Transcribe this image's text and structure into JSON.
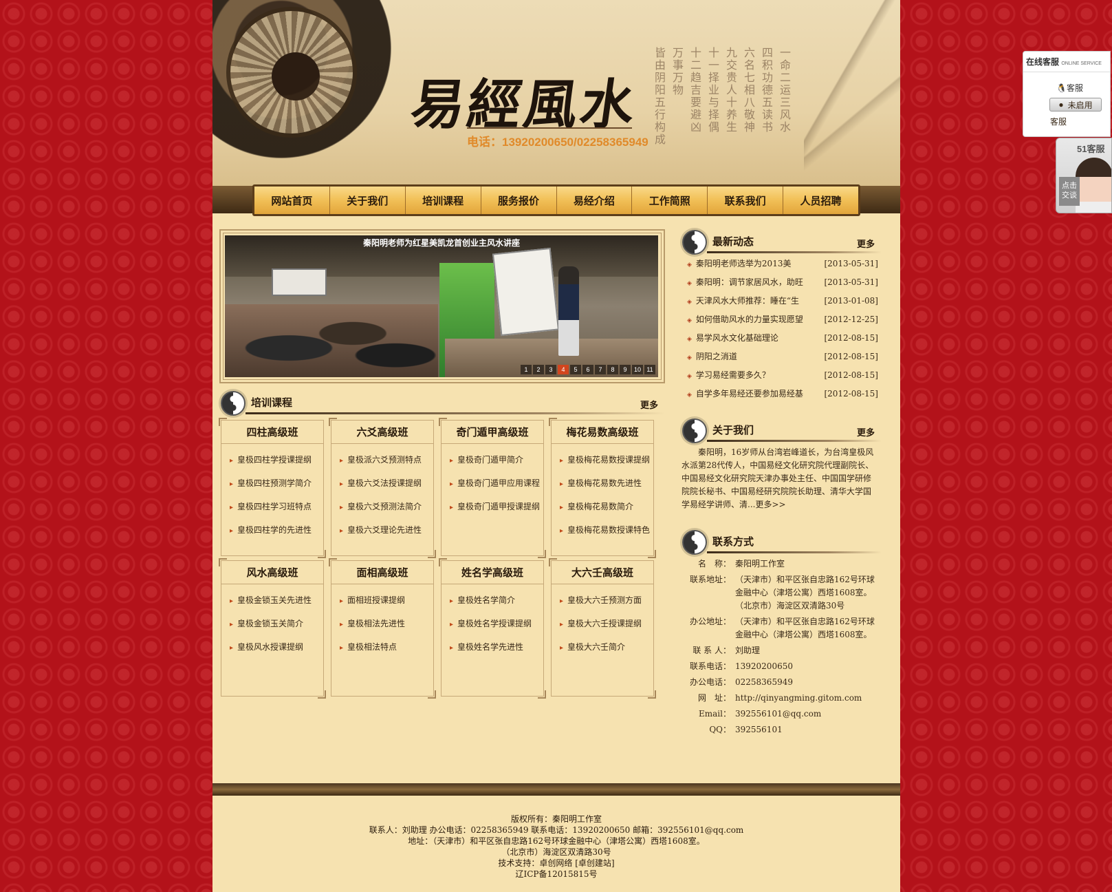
{
  "header": {
    "brand": "易經風水",
    "phone": "电话：13920200650/02258365949",
    "poem": [
      "一命二运三风水",
      "四积功德五读书",
      "六名七相八敬神",
      "九交贵人十养生",
      "十一择业与择偶",
      "十二趋吉要避凶",
      "万事万物",
      "皆由阴阳五行构成"
    ]
  },
  "nav": [
    "网站首页",
    "关于我们",
    "培训课程",
    "服务报价",
    "易经介绍",
    "工作简照",
    "联系我们",
    "人员招聘"
  ],
  "banner": {
    "caption": "秦阳明老师为红星美凯龙首创业主风水讲座",
    "pages": [
      "1",
      "2",
      "3",
      "4",
      "5",
      "6",
      "7",
      "8",
      "9",
      "10",
      "11"
    ],
    "active_page": "4"
  },
  "courses_section": {
    "title": "培训课程",
    "more": "更多"
  },
  "courses": [
    {
      "title": "四柱高级班",
      "items": [
        "皇极四柱学授课提纲",
        "皇极四柱预测学简介",
        "皇极四柱学习班特点",
        "皇极四柱学的先进性"
      ]
    },
    {
      "title": "六爻高级班",
      "items": [
        "皇极派六爻预测特点",
        "皇极六爻法授课提纲",
        "皇极六爻预测法简介",
        "皇极六爻理论先进性"
      ]
    },
    {
      "title": "奇门遁甲高级班",
      "items": [
        "皇极奇门遁甲简介",
        "皇极奇门遁甲应用课程",
        "皇极奇门遁甲授课提纲"
      ]
    },
    {
      "title": "梅花易数高级班",
      "items": [
        "皇极梅花易数授课提纲",
        "皇极梅花易数先进性",
        "皇极梅花易数简介",
        "皇极梅花易数授课特色"
      ]
    },
    {
      "title": "风水高级班",
      "items": [
        "皇极金锁玉关先进性",
        "皇极金锁玉关简介",
        "皇极风水授课提纲"
      ]
    },
    {
      "title": "面相高级班",
      "items": [
        "面相班授课提纲",
        "皇极相法先进性",
        "皇极相法特点"
      ]
    },
    {
      "title": "姓名学高级班",
      "items": [
        "皇极姓名学简介",
        "皇极姓名学授课提纲",
        "皇极姓名学先进性"
      ]
    },
    {
      "title": "大六壬高级班",
      "items": [
        "皇极大六壬预测方面",
        "皇极大六壬授课提纲",
        "皇极大六壬简介"
      ]
    }
  ],
  "news_section": {
    "title": "最新动态",
    "more": "更多"
  },
  "news": [
    {
      "title": "秦阳明老师选举为2013美",
      "date": "[2013-05-31]"
    },
    {
      "title": "秦阳明：调节家居风水，助旺",
      "date": "[2013-05-31]"
    },
    {
      "title": "天津风水大师推荐：睡在“生",
      "date": "[2013-01-08]"
    },
    {
      "title": "如何借助风水的力量实现愿望",
      "date": "[2012-12-25]"
    },
    {
      "title": "易学风水文化基础理论",
      "date": "[2012-08-15]"
    },
    {
      "title": "阴阳之消道",
      "date": "[2012-08-15]"
    },
    {
      "title": "学习易经需要多久？",
      "date": "[2012-08-15]"
    },
    {
      "title": "自学多年易经还要参加易经基",
      "date": "[2012-08-15]"
    }
  ],
  "about_section": {
    "title": "关于我们",
    "more": "更多"
  },
  "about_text": "秦阳明，16岁师从台湾岩峰道长，为台湾皇极风水派第28代传人，中国易经文化研究院代理副院长、中国易经文化研究院天津办事处主任、中国国学研修院院长秘书、中国易经研究院院长助理、清华大学国学易经学讲师、清...更多>>",
  "contact_section": {
    "title": "联系方式"
  },
  "contact": [
    {
      "k": "名　称：",
      "v": "秦阳明工作室"
    },
    {
      "k": "联系地址：",
      "v": "（天津市）和平区张自忠路162号环球金融中心（津塔公寓）西塔1608室。（北京市）海淀区双清路30号"
    },
    {
      "k": "办公地址：",
      "v": "（天津市）和平区张自忠路162号环球金融中心（津塔公寓）西塔1608室。"
    },
    {
      "k": "联 系 人：",
      "v": "刘助理"
    },
    {
      "k": "联系电话：",
      "v": "13920200650"
    },
    {
      "k": "办公电话：",
      "v": "02258365949"
    },
    {
      "k": "网　址：",
      "v": "http://qinyangming.gitom.com"
    },
    {
      "k": "Email：",
      "v": "392556101@qq.com"
    },
    {
      "k": "QQ：",
      "v": "392556101"
    }
  ],
  "footer": [
    "版权所有：秦阳明工作室",
    "联系人：刘助理 办公电话：02258365949 联系电话：13920200650 邮箱：392556101@qq.com",
    "地址：（天津市）和平区张自忠路162号环球金融中心（津塔公寓）西塔1608室。",
    "（北京市）海淀区双清路30号",
    "技术支持：卓创网络 [卓创建站]",
    "辽ICP备12015815号"
  ],
  "online_service": {
    "title": "在线客服",
    "subtitle": "ONLINE SERVICE",
    "qq_label": "客服",
    "button": "未启用",
    "label": "客服"
  },
  "kefu51": {
    "title": "51客服",
    "click": "点击交谈"
  }
}
